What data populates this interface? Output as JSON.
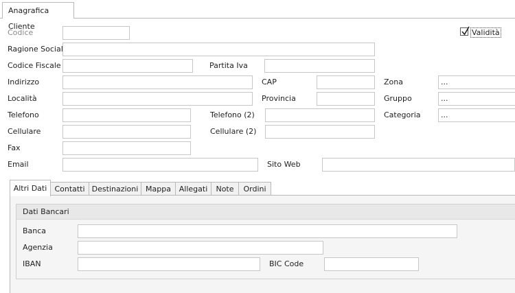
{
  "window": {
    "tab_label": "Anagrafica Cliente"
  },
  "validity": {
    "label": "Validità",
    "checked": true
  },
  "fields": {
    "codice": {
      "label": "Codice",
      "value": ""
    },
    "ragione_sociale": {
      "label": "Ragione Sociale",
      "value": ""
    },
    "codice_fiscale": {
      "label": "Codice Fiscale",
      "value": ""
    },
    "partita_iva": {
      "label": "Partita Iva",
      "value": ""
    },
    "indirizzo": {
      "label": "Indirizzo",
      "value": ""
    },
    "cap": {
      "label": "CAP",
      "value": ""
    },
    "zona": {
      "label": "Zona",
      "value": "..."
    },
    "localita": {
      "label": "Località",
      "value": ""
    },
    "provincia": {
      "label": "Provincia",
      "value": ""
    },
    "gruppo": {
      "label": "Gruppo",
      "value": "..."
    },
    "telefono": {
      "label": "Telefono",
      "value": ""
    },
    "telefono2": {
      "label": "Telefono (2)",
      "value": ""
    },
    "categoria": {
      "label": "Categoria",
      "value": "..."
    },
    "cellulare": {
      "label": "Cellulare",
      "value": ""
    },
    "cellulare2": {
      "label": "Cellulare (2)",
      "value": ""
    },
    "fax": {
      "label": "Fax",
      "value": ""
    },
    "email": {
      "label": "Email",
      "value": ""
    },
    "sito_web": {
      "label": "Sito Web",
      "value": ""
    }
  },
  "detail_tabs": [
    {
      "label": "Altri Dati",
      "active": true
    },
    {
      "label": "Contatti"
    },
    {
      "label": "Destinazioni"
    },
    {
      "label": "Mappa"
    },
    {
      "label": "Allegati"
    },
    {
      "label": "Note"
    },
    {
      "label": "Ordini"
    }
  ],
  "bank": {
    "title": "Dati Bancari",
    "banca": {
      "label": "Banca",
      "value": ""
    },
    "agenzia": {
      "label": "Agenzia",
      "value": ""
    },
    "iban": {
      "label": "IBAN",
      "value": ""
    },
    "bic": {
      "label": "BIC Code",
      "value": ""
    }
  }
}
